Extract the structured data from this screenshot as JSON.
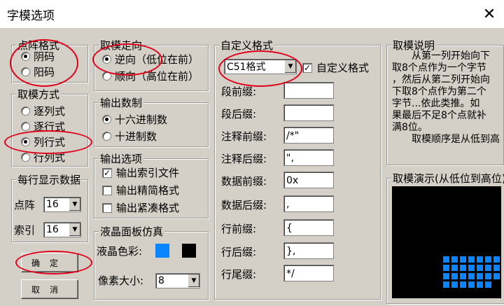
{
  "window": {
    "title": "字模选项",
    "close_glyph": "✕"
  },
  "dot_format": {
    "legend": "点阵格式",
    "options": [
      "阴码",
      "阳码"
    ],
    "selected": 0
  },
  "scan_mode": {
    "legend": "取模方式",
    "options": [
      "逐列式",
      "逐行式",
      "列行式",
      "行列式"
    ],
    "selected": 2
  },
  "per_line": {
    "legend": "每行显示数据",
    "dot_label": "点阵",
    "dot_value": "16",
    "index_label": "索引",
    "index_value": "16"
  },
  "buttons": {
    "ok": "确定",
    "cancel": "取消"
  },
  "direction": {
    "legend": "取模走向",
    "options": [
      "逆向（低位在前）",
      "顺向（高位在前）"
    ],
    "selected": 0
  },
  "output_base": {
    "legend": "输出数制",
    "options": [
      "十六进制数",
      "十进制数"
    ],
    "selected": 0
  },
  "output_opts": {
    "legend": "输出选项",
    "items": [
      {
        "label": "输出索引文件",
        "checked": true
      },
      {
        "label": "输出精简格式",
        "checked": false
      },
      {
        "label": "输出紧凑格式",
        "checked": false
      }
    ]
  },
  "lcd": {
    "legend": "液晶面板仿真",
    "color_label": "液晶色彩:",
    "pixel_label": "像素大小:",
    "pixel_value": "8",
    "color_on": "#0a84ff",
    "color_off": "#000000"
  },
  "custom": {
    "legend": "自定义格式",
    "format_value": "C51格式",
    "custom_check_label": "自定义格式",
    "custom_checked": true,
    "fields": [
      {
        "label": "段前缀:",
        "value": ""
      },
      {
        "label": "段后缀:",
        "value": ""
      },
      {
        "label": "注释前缀:",
        "value": "/*\""
      },
      {
        "label": "注释后缀:",
        "value": "\","
      },
      {
        "label": "数据前缀:",
        "value": "0x"
      },
      {
        "label": "数据后缀:",
        "value": ","
      },
      {
        "label": "行前缀:",
        "value": "{"
      },
      {
        "label": "行后缀:",
        "value": "},"
      },
      {
        "label": "行尾缀:",
        "value": "*/"
      }
    ]
  },
  "explain": {
    "legend": "取模说明",
    "lines": [
      "从第一列开始向下",
      "取8个点作为一个字节",
      "，然后从第二列开始向",
      "下取8个点作为第二个",
      "字节...依此类推。如",
      "果最后不足8个点就补",
      "满8位。",
      "取模顺序是从低到高"
    ]
  },
  "demo": {
    "legend": "取模演示(从低位到高位)",
    "grid_rows": 4,
    "grid_cols": 7
  }
}
